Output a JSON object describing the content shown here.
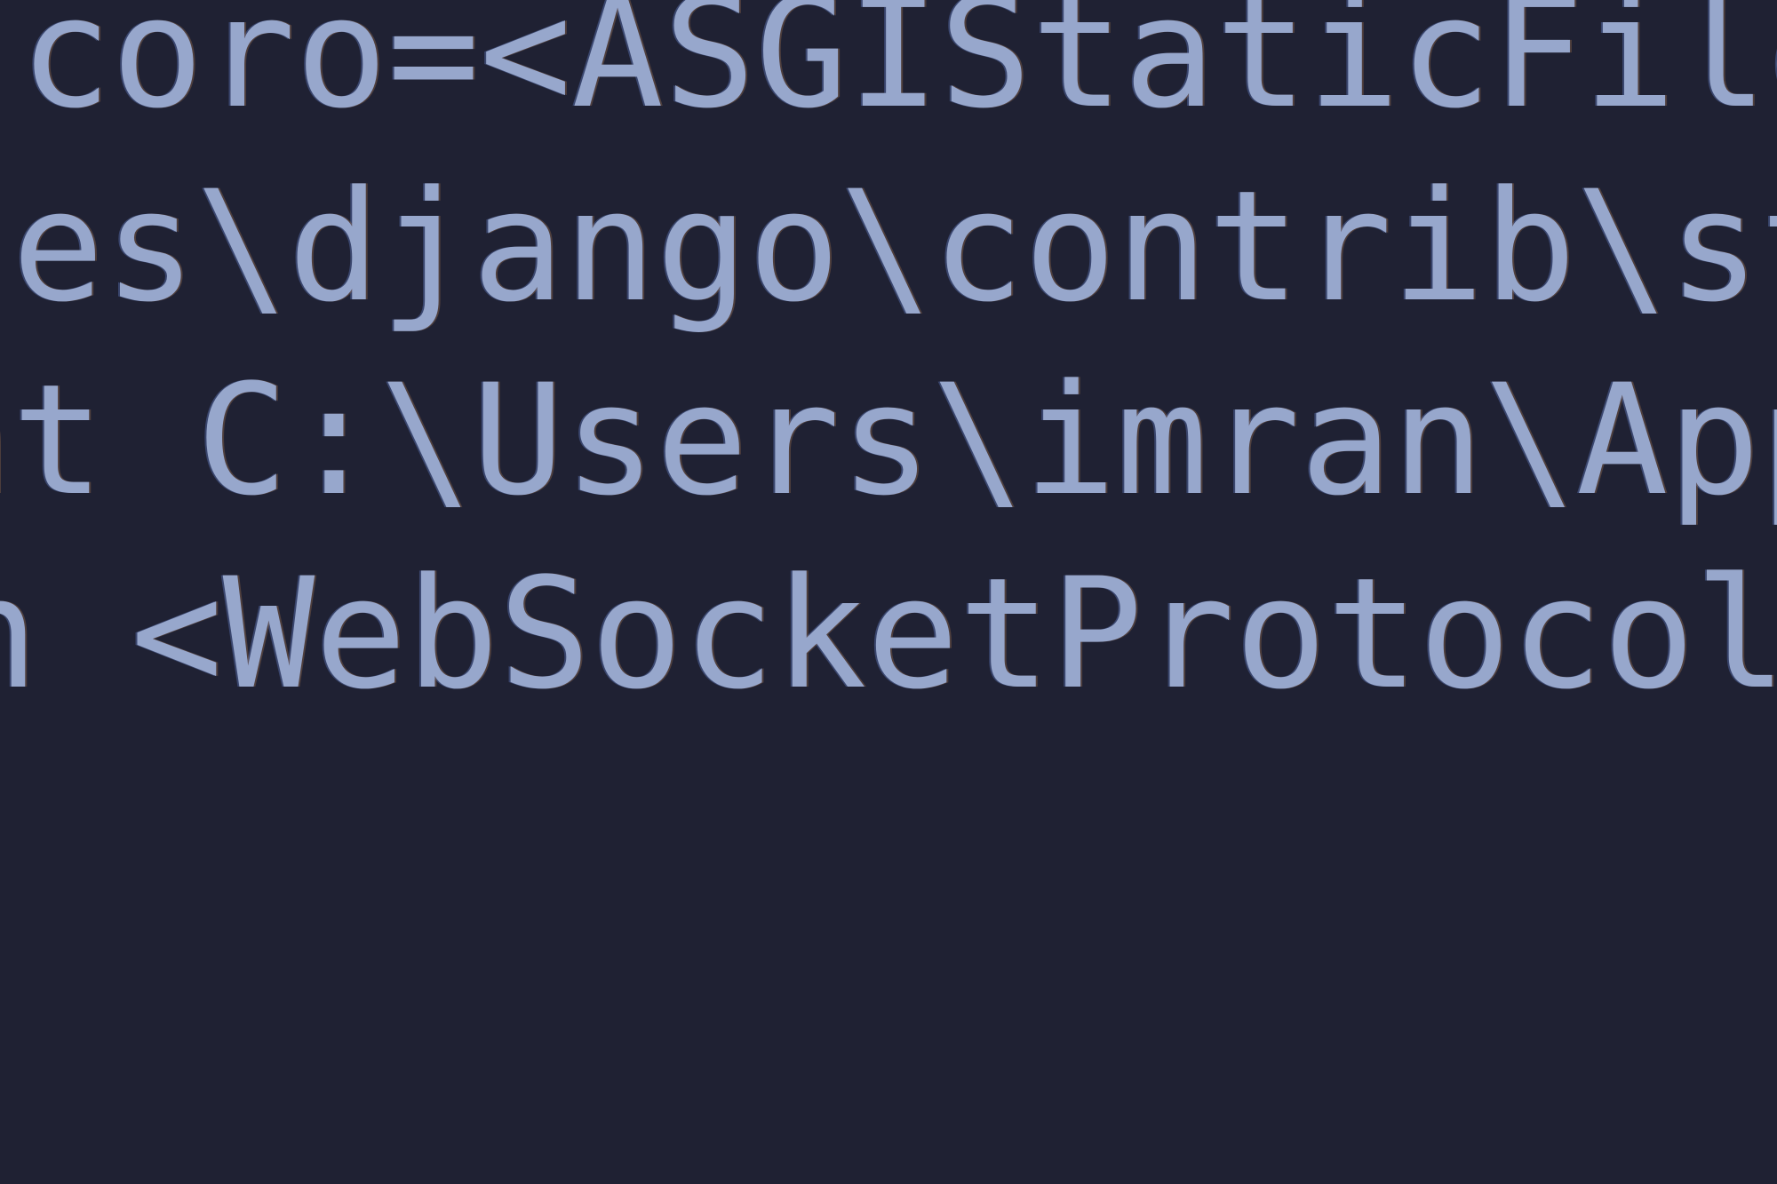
{
  "terminal": {
    "lines": [
      "coro=<ASGIStaticFile",
      "ges\\django\\contrib\\st",
      "at C:\\Users\\imran\\AppD",
      "n <WebSocketProtocol"
    ]
  }
}
